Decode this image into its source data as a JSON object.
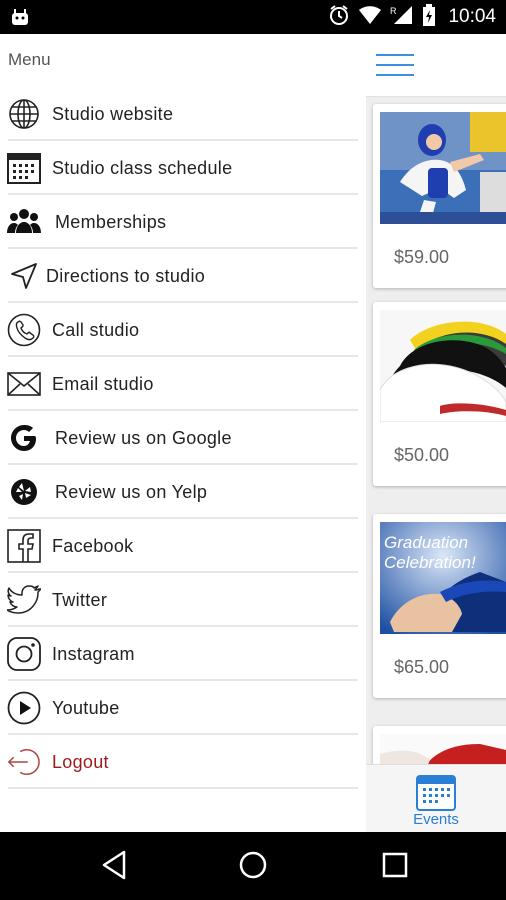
{
  "status_bar": {
    "time": "10:04",
    "icons": [
      "android-icon",
      "alarm-icon",
      "wifi-icon",
      "signal-icon",
      "battery-icon"
    ]
  },
  "drawer": {
    "title": "Menu",
    "items": [
      {
        "label": "Studio website",
        "icon": "globe-icon"
      },
      {
        "label": "Studio class schedule",
        "icon": "calendar-icon"
      },
      {
        "label": "Memberships",
        "icon": "group-icon"
      },
      {
        "label": "Directions to studio",
        "icon": "navigation-arrow-icon"
      },
      {
        "label": "Call studio",
        "icon": "phone-icon"
      },
      {
        "label": "Email studio",
        "icon": "envelope-icon"
      },
      {
        "label": "Review us on Google",
        "icon": "google-icon"
      },
      {
        "label": "Review us on Yelp",
        "icon": "yelp-icon"
      },
      {
        "label": "Facebook",
        "icon": "facebook-icon"
      },
      {
        "label": "Twitter",
        "icon": "twitter-icon"
      },
      {
        "label": "Instagram",
        "icon": "instagram-icon"
      },
      {
        "label": "Youtube",
        "icon": "youtube-icon"
      },
      {
        "label": "Logout",
        "icon": "logout-icon"
      }
    ]
  },
  "content": {
    "cards": [
      {
        "price": "$59.00",
        "image": "taekwondo-kid-photo"
      },
      {
        "price": "$50.00",
        "image": "colored-belts-photo"
      },
      {
        "price": "$65.00",
        "image": "graduation-celebration-photo",
        "image_text": "Graduation Celebration!"
      }
    ],
    "bottom_nav": {
      "events_label": "Events"
    }
  },
  "colors": {
    "accent": "#3d8fe0",
    "logout": "#9b1c1c"
  },
  "nav_bar": {
    "icons": [
      "back-icon",
      "home-icon",
      "recents-icon"
    ]
  }
}
